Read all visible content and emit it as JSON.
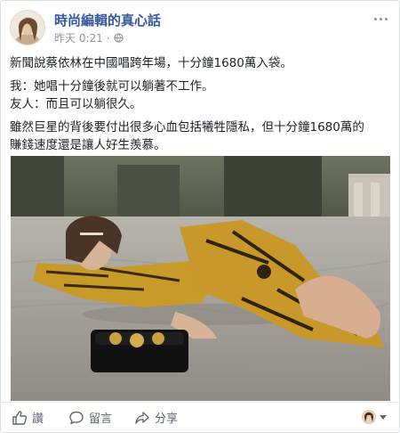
{
  "page": {
    "name": "時尚編輯的真心話"
  },
  "post": {
    "time": "昨天 0:21",
    "privacy_sep": "·",
    "lines": [
      "新聞說蔡依林在中國唱跨年場，十分鐘1680萬入袋。",
      "我：她唱十分鐘後就可以躺著不工作。",
      "友人：而且可以躺很久。",
      "雖然巨星的背後要付出很多心血包括犧牲隱私，但十分鐘1680萬的",
      "賺錢速度還是讓人好生羨慕。"
    ]
  },
  "actions": {
    "like": "讚",
    "comment": "留言",
    "share": "分享"
  },
  "icons": {
    "globe": "globe-icon",
    "more": "more-options-icon",
    "like": "thumbs-up-icon",
    "comment": "comment-bubble-icon",
    "share": "share-arrow-icon",
    "viewer_caret": "chevron-down-icon"
  },
  "colors": {
    "page_name": "#365899",
    "meta": "#90949c",
    "action_text": "#606770",
    "border": "#dddfe2"
  }
}
